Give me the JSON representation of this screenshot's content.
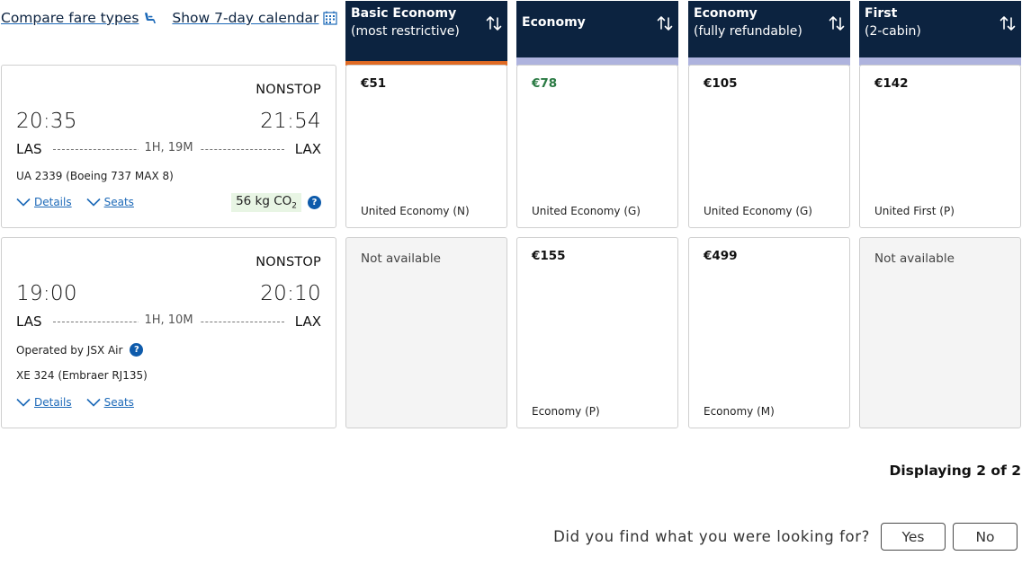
{
  "top_links": {
    "compare_label": "Compare fare types",
    "compare_icon": "seat-icon",
    "calendar_label": "Show 7-day calendar",
    "calendar_icon": "calendar-icon"
  },
  "fare_columns": [
    {
      "title": "Basic Economy",
      "subtitle": "(most restrictive)",
      "accent": "#e06a23",
      "sort_icon": "sort-icon"
    },
    {
      "title": "Economy",
      "subtitle": "",
      "accent": "#aeb3de",
      "sort_icon": "sort-icon"
    },
    {
      "title": "Economy",
      "subtitle": "(fully refundable)",
      "accent": "#aeb3de",
      "sort_icon": "sort-icon"
    },
    {
      "title": "First",
      "subtitle": "(2-cabin)",
      "accent": "#aeb3de",
      "sort_icon": "sort-icon"
    }
  ],
  "flights": [
    {
      "stops": "NONSTOP",
      "depart_time": "20:35",
      "arrive_time": "21:54",
      "origin": "LAS",
      "destination": "LAX",
      "duration": "1H, 19M",
      "flight_number": "UA 2339 (Boeing 737 MAX 8)",
      "details_label": "Details",
      "seats_label": "Seats",
      "co2_value": "56 kg CO",
      "co2_sub": "2",
      "help_icon": "?",
      "fares": [
        {
          "price": "€51",
          "cabin": "United Economy (N)"
        },
        {
          "price": "€78",
          "cabin": "United Economy (G)"
        },
        {
          "price": "€105",
          "cabin": "United Economy (G)"
        },
        {
          "price": "€142",
          "cabin": "United First (P)"
        }
      ]
    },
    {
      "stops": "NONSTOP",
      "depart_time": "19:00",
      "arrive_time": "20:10",
      "origin": "LAS",
      "destination": "LAX",
      "duration": "1H, 10M",
      "operated_by": "Operated by JSX Air",
      "flight_number": "XE 324 (Embraer RJ135)",
      "details_label": "Details",
      "seats_label": "Seats",
      "help_icon": "?",
      "fares": [
        {
          "not_available": "Not available"
        },
        {
          "price": "€155",
          "cabin": "Economy (P)"
        },
        {
          "price": "€499",
          "cabin": "Economy (M)"
        },
        {
          "not_available": "Not available"
        }
      ]
    }
  ],
  "colors": {
    "header_navy": "#0c2340",
    "link_blue": "#1c69b8",
    "price_green": "#2a7a43",
    "co2_bg": "#e8f5e4"
  },
  "results": {
    "displaying": "Displaying 2 of 2"
  },
  "feedback": {
    "question": "Did you find what you were looking for?",
    "yes": "Yes",
    "no": "No"
  }
}
